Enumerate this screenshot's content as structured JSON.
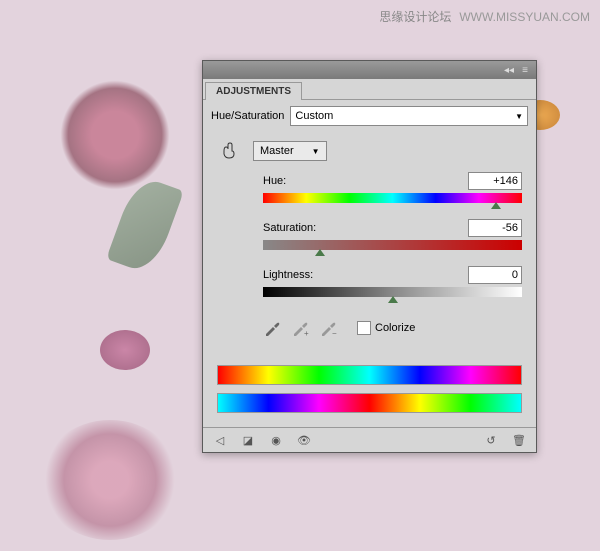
{
  "watermark": {
    "cn": "思缘设计论坛",
    "url": "WWW.MISSYUAN.COM"
  },
  "panel": {
    "tab": "ADJUSTMENTS",
    "title": "Hue/Saturation",
    "preset": "Custom",
    "channel": "Master",
    "hue": {
      "label": "Hue:",
      "value": "+146",
      "pos": 90
    },
    "saturation": {
      "label": "Saturation:",
      "value": "-56",
      "pos": 22
    },
    "lightness": {
      "label": "Lightness:",
      "value": "0",
      "pos": 50
    },
    "colorize": "Colorize"
  }
}
